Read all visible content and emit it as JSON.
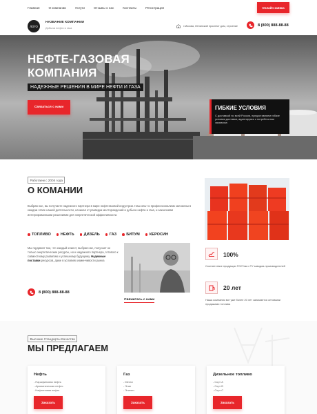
{
  "nav": {
    "links": [
      "Главная",
      "О компании",
      "Услуги",
      "Отзывы о нас",
      "Контакты",
      "Регистрация"
    ],
    "online_button": "Онлайн заявка"
  },
  "header": {
    "logo_text": "ЛОГО",
    "company_name": "НАЗВАНИЕ КОМПАНИИ",
    "tagline": "Добыча нефти и газа",
    "address": "г.Москва, Ленинский проспект дом, строение",
    "phone": "8 (800) 888-88-88"
  },
  "hero": {
    "title_line1": "НЕФТЕ-ГАЗОВАЯ",
    "title_line2": "КОМПАНИЯ",
    "subtitle": "НАДЕЖНЫЕ РЕШЕНИЯ В МИРЕ НЕФТИ И ГАЗА",
    "contact_button": "Связаться с нами",
    "flex_title": "ГИБКИЕ УСЛОВИЯ",
    "flex_text": "С доставкой по всей России, предоставляем гибкие условия доставки, адаптируясь к потребностям заказчика"
  },
  "about": {
    "since_badge": "Работаем с 2004 года",
    "title": "О КОМАНИИ",
    "paragraph": "Выбрав нас, вы получаете надежного партнера в мире нефтегазовой индустрии. Наш опыт и профессионализм заложены в каждом этапе нашей деятельности, начиная от разведки месторождений и добычи нефти и газа, и заканчивая интегрированными решениями для энергетической эффективности.",
    "products": [
      "ТОПЛИВО",
      "НЕФТЬ",
      "ДИЗЕЛЬ",
      "ГАЗ",
      "БИТУМ",
      "КЕРОСИН"
    ],
    "proud_text_start": "Мы гордимся тем, что каждый клиент, выбрав нас, получает не только энергетические ресурсы, но и надежного партнера, готового к совместному развитию и успешному будущему.",
    "proud_bold": "Надежные поставки",
    "proud_text_end": "ресурсов, даже в условиях изменчивости рынка",
    "phone": "8 (800) 888-88-88",
    "contact_link": "Свяжитесь с нами"
  },
  "stats": [
    {
      "value": "100%",
      "text": "Соответствие продукции ГОСТам и ТУ заводов-производителей"
    },
    {
      "value": "20 лет",
      "text": "Наша компания вот уже более 20 лет занимается оптовыми продажами топлива"
    }
  ],
  "offer": {
    "quality_badge": "Высокие Стандарты Качества",
    "title": "МЫ ПРЕДЛАГАЕМ",
    "order_button": "Заказать",
    "cards": [
      {
        "title": "Нефть",
        "items": [
          "- Парафиновая нефть",
          "- Ароматическая нефть",
          "- Нафтеновая нефть"
        ]
      },
      {
        "title": "Газ",
        "items": [
          "- Метан",
          "- Этан",
          "- Этилен"
        ]
      },
      {
        "title": "Дизельное топливо",
        "items": [
          "- Сорт А",
          "- Сорт В",
          "- Сорт С"
        ]
      }
    ]
  },
  "colors": {
    "accent": "#e8262b",
    "dark": "#111111"
  }
}
